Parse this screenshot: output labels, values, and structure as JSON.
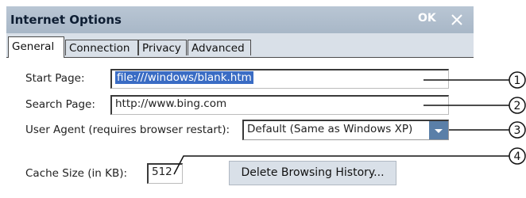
{
  "window": {
    "title": "Internet Options",
    "ok_label": "OK"
  },
  "tabs": [
    {
      "label": "General",
      "active": true
    },
    {
      "label": "Connection",
      "active": false
    },
    {
      "label": "Privacy",
      "active": false
    },
    {
      "label": "Advanced",
      "active": false
    }
  ],
  "general": {
    "start_page_label": "Start Page:",
    "start_page_value": "file:///windows/blank.htm",
    "search_page_label": "Search Page:",
    "search_page_value": "http://www.bing.com",
    "user_agent_label": "User Agent (requires browser restart):",
    "user_agent_value": "Default (Same as Windows XP)",
    "cache_size_label": "Cache Size (in KB):",
    "cache_size_value": "512",
    "delete_history_label": "Delete Browsing History..."
  },
  "callouts": [
    "1",
    "2",
    "3",
    "4"
  ],
  "colors": {
    "titlebar": "#afbdcc",
    "window_bg": "#d9e0e8",
    "selection": "#3a6cc4",
    "dropdown_button": "#5a7fa8"
  }
}
